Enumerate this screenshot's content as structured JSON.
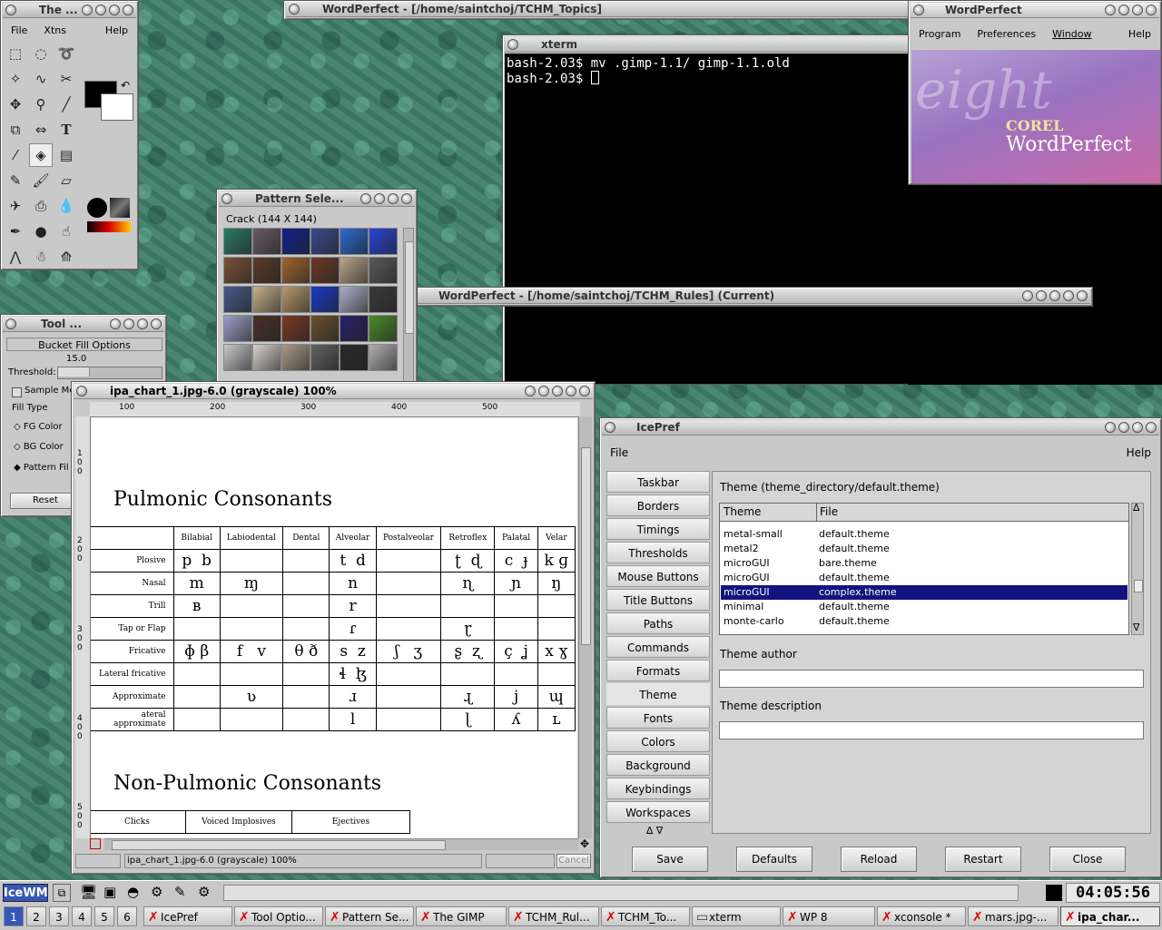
{
  "gimp_toolbox": {
    "title": "The ...",
    "menu": [
      "File",
      "Xtns",
      "Help"
    ],
    "tools": [
      "rect-select-icon",
      "ellipse-select-icon",
      "lasso-icon",
      "fuzzy-select-icon",
      "bezier-select-icon",
      "scissors-icon",
      "move-icon",
      "magnify-icon",
      "crop-icon",
      "transform-icon",
      "flip-icon",
      "text-icon",
      "color-picker-icon",
      "bucket-fill-icon",
      "blend-icon",
      "pencil-icon",
      "paintbrush-icon",
      "eraser-icon",
      "airbrush-icon",
      "clone-icon",
      "convolve-icon",
      "ink-icon",
      "dodge-burn-icon",
      "smudge-icon",
      "measure-icon",
      "xinput-icon",
      "path-icon"
    ]
  },
  "tool_options": {
    "title": "Tool ...",
    "heading": "Bucket Fill Options",
    "threshold_value": "15.0",
    "threshold_label": "Threshold:",
    "sample_merged": "Sample Me",
    "fill_type_label": "Fill Type",
    "fill_types": [
      "FG Color",
      "BG Color",
      "Pattern Fil"
    ],
    "reset": "Reset"
  },
  "pattern_select": {
    "title": "Pattern Sele...",
    "current": "Crack  (144 X 144)",
    "patterns": [
      "#2a7a66",
      "#6b5a64",
      "#10228a",
      "#3b4a8e",
      "#2b6ad0",
      "#2844d8",
      "#7a5238",
      "#5a3a28",
      "#a0642e",
      "#6a3a24",
      "#b8a488",
      "#5a5a5a",
      "#4a5a8a",
      "#c8b08a",
      "#b89a6a",
      "#1a3ac8",
      "#a8b0c8",
      "#3a3a3a",
      "#9aa0c8",
      "#4a3028",
      "#7a3a24",
      "#6a5030",
      "#2a2068",
      "#4a8a2a",
      "#c8c8c8",
      "#d8d4cc",
      "#a89a88",
      "#606060",
      "#2a2a2a",
      "#b0b0b0"
    ]
  },
  "wp_topics": {
    "title": "WordPerfect - [/home/saintchoj/TCHM_Topics]"
  },
  "xterm": {
    "title": "xterm",
    "lines": [
      "bash-2.03$ mv .gimp-1.1/ gimp-1.1.old",
      "bash-2.03$ "
    ]
  },
  "wp_main": {
    "title": "WordPerfect",
    "menu": [
      "Program",
      "Preferences",
      "Window",
      "Help"
    ],
    "splash_eight": "eight",
    "splash_corel": "COREL",
    "splash_product": "WordPerfect",
    "colors": {
      "splash_top": "#a889c9",
      "splash_bottom": "#c96aa8"
    }
  },
  "wp_rules": {
    "title": "WordPerfect - [/home/saintchoj/TCHM_Rules]  (Current)"
  },
  "image_window": {
    "title": "ipa_chart_1.jpg-6.0 (grayscale) 100%",
    "ruler_ticks": [
      "100",
      "200",
      "300",
      "400",
      "500"
    ],
    "vruler_ticks": [
      "1 0 0",
      "2 0 0",
      "3 0 0",
      "4 0 0",
      "5 0 0"
    ],
    "status": "ipa_chart_1.jpg-6.0 (grayscale) 100%",
    "cancel": "Cancel",
    "heading1": "Pulmonic Consonants",
    "heading2": "Non-Pulmonic Consonants",
    "columns": [
      "Bilabial",
      "Labiodental",
      "Dental",
      "Alveolar",
      "Postalveolar",
      "Retroflex",
      "Palatal",
      "Velar"
    ],
    "rows": [
      {
        "label": "Plosive",
        "cells": [
          "p  b",
          "",
          "",
          "t  d",
          "",
          "ʈ  ɖ",
          "c  ɟ",
          "k ɡ"
        ]
      },
      {
        "label": "Nasal",
        "cells": [
          "m",
          "ɱ",
          "",
          "n",
          "",
          "ɳ",
          "ɲ",
          "ŋ"
        ]
      },
      {
        "label": "Trill",
        "cells": [
          "ʙ",
          "",
          "",
          "r",
          "",
          "",
          "",
          ""
        ]
      },
      {
        "label": "Tap or Flap",
        "cells": [
          "",
          "",
          "",
          "ɾ",
          "",
          "ɽ",
          "",
          ""
        ]
      },
      {
        "label": "Fricative",
        "cells": [
          "ɸ β",
          "f   v",
          "θ ð",
          "s  z",
          "ʃ   ʒ",
          "ʂ  ʐ",
          "ç  ʝ",
          "x ɣ"
        ]
      },
      {
        "label": "Lateral fricative",
        "cells": [
          "",
          "",
          "",
          "ɬ  ɮ",
          "",
          "",
          "",
          ""
        ]
      },
      {
        "label": "Approximate",
        "cells": [
          "",
          "ʋ",
          "",
          "ɹ",
          "",
          "ɻ",
          "j",
          "ɰ"
        ]
      },
      {
        "label": "ateral approximate",
        "cells": [
          "",
          "",
          "",
          "l",
          "",
          "ɭ",
          "ʎ",
          "ʟ"
        ]
      }
    ],
    "np_columns": [
      "Clicks",
      "Voiced Implosives",
      "Ejectives"
    ]
  },
  "icepref": {
    "title": "IcePref",
    "menu_file": "File",
    "menu_help": "Help",
    "nav": [
      "Taskbar",
      "Borders",
      "Timings",
      "Thresholds",
      "Mouse Buttons",
      "Title Buttons",
      "Paths",
      "Commands",
      "Formats",
      "Theme",
      "Fonts",
      "Colors",
      "Background",
      "Keybindings",
      "Workspaces"
    ],
    "selected_nav": "Theme",
    "theme_heading": "Theme (theme_directory/default.theme)",
    "col_theme": "Theme",
    "col_file": "File",
    "themes": [
      {
        "theme": "metal-small",
        "file": "default.theme"
      },
      {
        "theme": "metal2",
        "file": "default.theme"
      },
      {
        "theme": "microGUI",
        "file": "bare.theme"
      },
      {
        "theme": "microGUI",
        "file": "default.theme"
      },
      {
        "theme": "microGUI",
        "file": "complex.theme"
      },
      {
        "theme": "minimal",
        "file": "default.theme"
      },
      {
        "theme": "monte-carlo",
        "file": "default.theme"
      }
    ],
    "selected_theme_index": 4,
    "author_label": "Theme author",
    "author_value": "",
    "description_label": "Theme description",
    "description_value": "",
    "buttons": [
      "Save",
      "Defaults",
      "Reload",
      "Restart",
      "Close"
    ]
  },
  "taskbar": {
    "logo": "IceWM",
    "clock": "04:05:56",
    "workspaces": [
      "1",
      "2",
      "3",
      "4",
      "5",
      "6"
    ],
    "current_workspace": "1",
    "tasks": [
      {
        "label": "IcePref",
        "icon": "x-icon"
      },
      {
        "label": "Tool Optio...",
        "icon": "x-icon"
      },
      {
        "label": "Pattern Se...",
        "icon": "x-icon"
      },
      {
        "label": "The GIMP",
        "icon": "x-icon"
      },
      {
        "label": "TCHM_Rul...",
        "icon": "x-icon"
      },
      {
        "label": "TCHM_To...",
        "icon": "x-icon"
      },
      {
        "label": "xterm",
        "icon": "terminal-icon"
      },
      {
        "label": "WP 8",
        "icon": "x-icon"
      },
      {
        "label": "xconsole *",
        "icon": "x-icon"
      },
      {
        "label": "mars.jpg-...",
        "icon": "x-icon"
      },
      {
        "label": "ipa_char...",
        "icon": "x-icon"
      }
    ],
    "active_task": "ipa_char..."
  }
}
